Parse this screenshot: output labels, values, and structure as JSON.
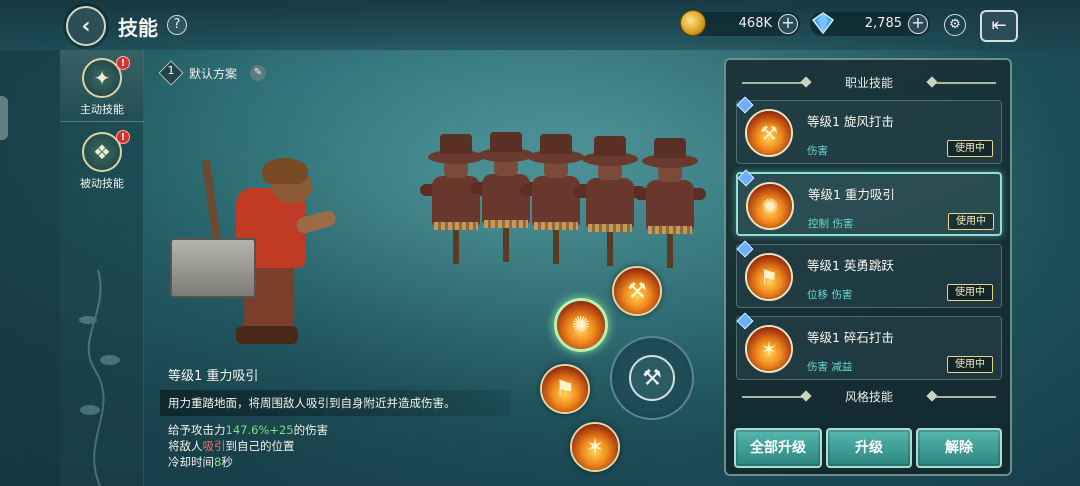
{
  "header": {
    "title": "技能",
    "help": "?",
    "gold_value": "468K",
    "gem_value": "2,785",
    "plus": "+"
  },
  "tabs": [
    {
      "label": "主动技能",
      "badge": "!",
      "active": true,
      "icon": "active-skill-emblem-icon"
    },
    {
      "label": "被动技能",
      "badge": "!",
      "active": false,
      "icon": "passive-skill-emblem-icon"
    }
  ],
  "preset": {
    "number": "1",
    "name": "默认方案"
  },
  "selected_skill": {
    "level_name": "等级1 重力吸引",
    "description": "用力重踏地面，将周围敌人吸引到自身附近并造成伤害。",
    "detail_1_prefix": "给予攻击力",
    "detail_1_pct": "147.6%",
    "detail_1_plus": "+25",
    "detail_1_suffix": "的伤害",
    "detail_2_prefix": "将敌人",
    "detail_2_hl": "吸引",
    "detail_2_suffix": "到自己的位置",
    "detail_3_prefix": "冷却时间",
    "detail_3_val": "8",
    "detail_3_suffix": "秒"
  },
  "panel": {
    "section_class": "职业技能",
    "section_style": "风格技能",
    "skills": [
      {
        "title": "等级1 旋风打击",
        "tags": "伤害",
        "status": "使用中",
        "selected": false
      },
      {
        "title": "等级1 重力吸引",
        "tags": "控制 伤害",
        "status": "使用中",
        "selected": true
      },
      {
        "title": "等级1 英勇跳跃",
        "tags": "位移 伤害",
        "status": "使用中",
        "selected": false
      },
      {
        "title": "等级1 碎石打击",
        "tags": "伤害 减益",
        "status": "使用中",
        "selected": false
      }
    ]
  },
  "buttons": {
    "upgrade_all": "全部升级",
    "upgrade": "升级",
    "unequip": "解除"
  },
  "colors": {
    "accent_teal": "#3a9d95",
    "tag_teal": "#67d9d2",
    "highlight_green": "#7de07a",
    "highlight_red": "#ff6b5b",
    "badge_red": "#d72f2f"
  }
}
